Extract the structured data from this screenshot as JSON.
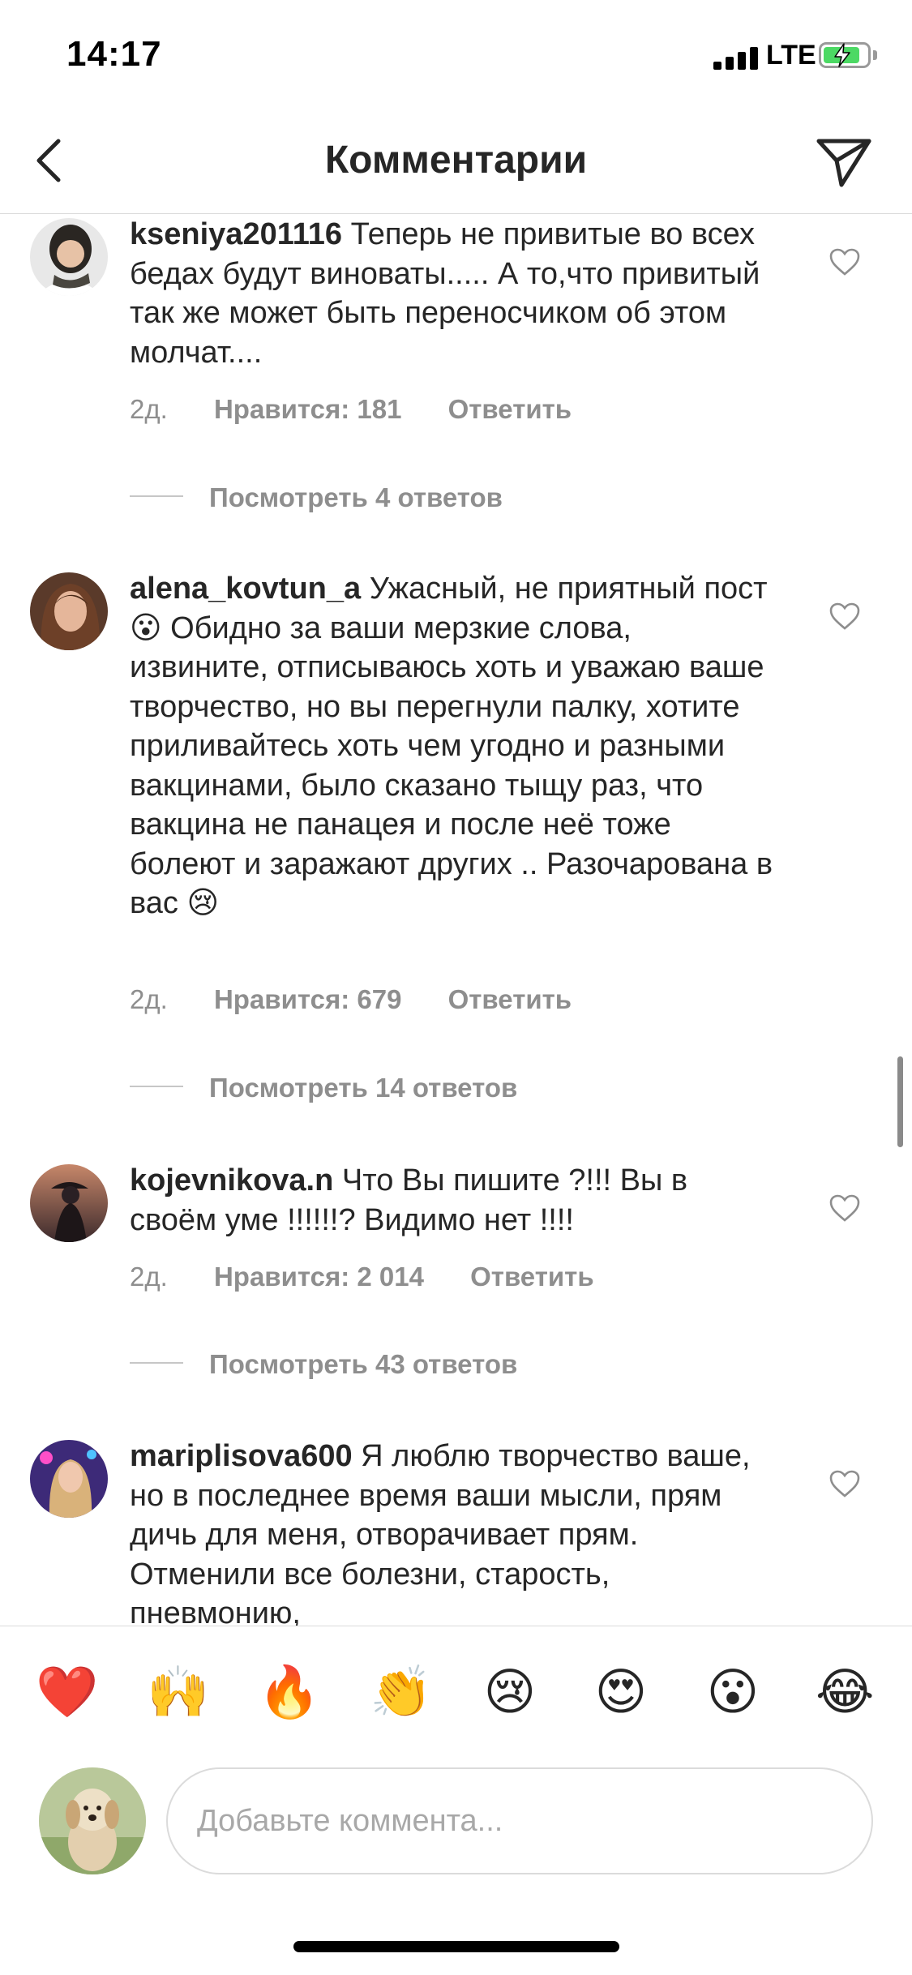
{
  "status_bar": {
    "time": "14:17",
    "network": "LTE",
    "battery_color": "#4cd964"
  },
  "header": {
    "title": "Комментарии",
    "back_icon": "chevron-left-icon",
    "send_icon": "paper-plane-icon"
  },
  "comments": [
    {
      "username": "kseniya201116",
      "text": "Теперь не привитые во всех  бедах будут виноваты..... А то,что привитый так же может быть переносчиком об этом молчат....",
      "age": "2д.",
      "likes": "Нравится: 181",
      "reply": "Ответить",
      "view_replies": "Посмотреть 4 ответов"
    },
    {
      "username": "alena_kovtun_a",
      "text_part1": "Ужасный, не приятный пост",
      "emoji1": "😮",
      "text_part2": " Обидно за ваши мерзкие слова, извините, отписываюсь хоть и уважаю ваше творчество, но вы перегнули палку, хотите приливайтесь хоть чем угодно и разными вакцинами, было сказано тыщу раз, что вакцина не панацея и после неё тоже болеют и заражают других .. Разочарована в вас ",
      "emoji2": "😢",
      "age": "2д.",
      "likes": "Нравится: 679",
      "reply": "Ответить",
      "view_replies": "Посмотреть 14 ответов"
    },
    {
      "username": "kojevnikova.n",
      "text": "Что Вы пишите ?!!! Вы в своём уме !!!!!!? Видимо нет !!!!",
      "age": "2д.",
      "likes": "Нравится: 2 014",
      "reply": "Ответить",
      "view_replies": "Посмотреть 43 ответов"
    },
    {
      "username": "mariplisova600",
      "text": "Я люблю творчество ваше, но в последнее время ваши мысли, прям дичь для меня, отворачивает прям. Отменили все болезни, старость, пневмонию,"
    }
  ],
  "emoji_bar": [
    "❤️",
    "🙌",
    "🔥",
    "👏",
    "😢",
    "😍",
    "😮",
    "😂"
  ],
  "composer": {
    "placeholder": "Добавьте коммента..."
  }
}
